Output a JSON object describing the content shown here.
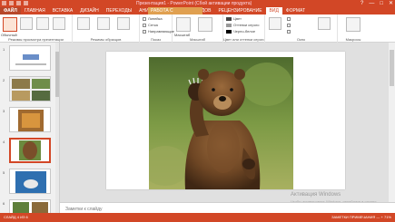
{
  "window": {
    "title": "Презентация1 - PowerPoint (Сбой активации продукта)",
    "controls": [
      "?",
      "—",
      "□",
      "✕"
    ]
  },
  "tabs": [
    {
      "label": "ФАЙЛ"
    },
    {
      "label": "ГЛАВНАЯ"
    },
    {
      "label": "ВСТАВКА"
    },
    {
      "label": "ДИЗАЙН"
    },
    {
      "label": "ПЕРЕХОДЫ"
    },
    {
      "label": "АНИМАЦИЯ"
    },
    {
      "label": "ПОКАЗ СЛАЙДОВ"
    },
    {
      "label": "РЕЦЕНЗИРОВАНИЕ"
    },
    {
      "label": "ВИД"
    },
    {
      "label": "ФОРМАТ"
    }
  ],
  "contextual_tab": "РАБОТА С РИСУНКАМИ",
  "ribbon": {
    "groups": [
      {
        "label": "Режимы просмотра презентации"
      },
      {
        "label": "Режимы образцов"
      },
      {
        "label": "Показ"
      },
      {
        "label": "Масштаб"
      },
      {
        "label": "Цвет или оттенки серого"
      },
      {
        "label": "Окно"
      },
      {
        "label": "Макросы"
      }
    ],
    "show": {
      "ruler": "Линейка",
      "grid": "Сетка",
      "guides": "Направляющие"
    },
    "color": {
      "color": "Цвет",
      "grayscale": "Оттенки серого",
      "bw": "Черно-белое"
    },
    "buttons": {
      "normal": "Обычный",
      "zoom": "Масштаб",
      "fit": "Вписать в окно",
      "macros": "Макросы"
    }
  },
  "slides": [
    {
      "number": "1"
    },
    {
      "number": "2"
    },
    {
      "number": "3"
    },
    {
      "number": "4"
    },
    {
      "number": "5"
    },
    {
      "number": "6"
    }
  ],
  "notes_placeholder": "Заметки к слайду",
  "watermark": {
    "line1": "Активация Windows",
    "line2": "Чтобы активировать Windows, перейдите в раздел"
  },
  "status": {
    "left": "СЛАЙД 4 ИЗ 6",
    "right": "ЗАМЕТКИ  ПРИМЕЧАНИЯ  —  + 71%"
  },
  "colors": {
    "accent": "#d24726"
  }
}
